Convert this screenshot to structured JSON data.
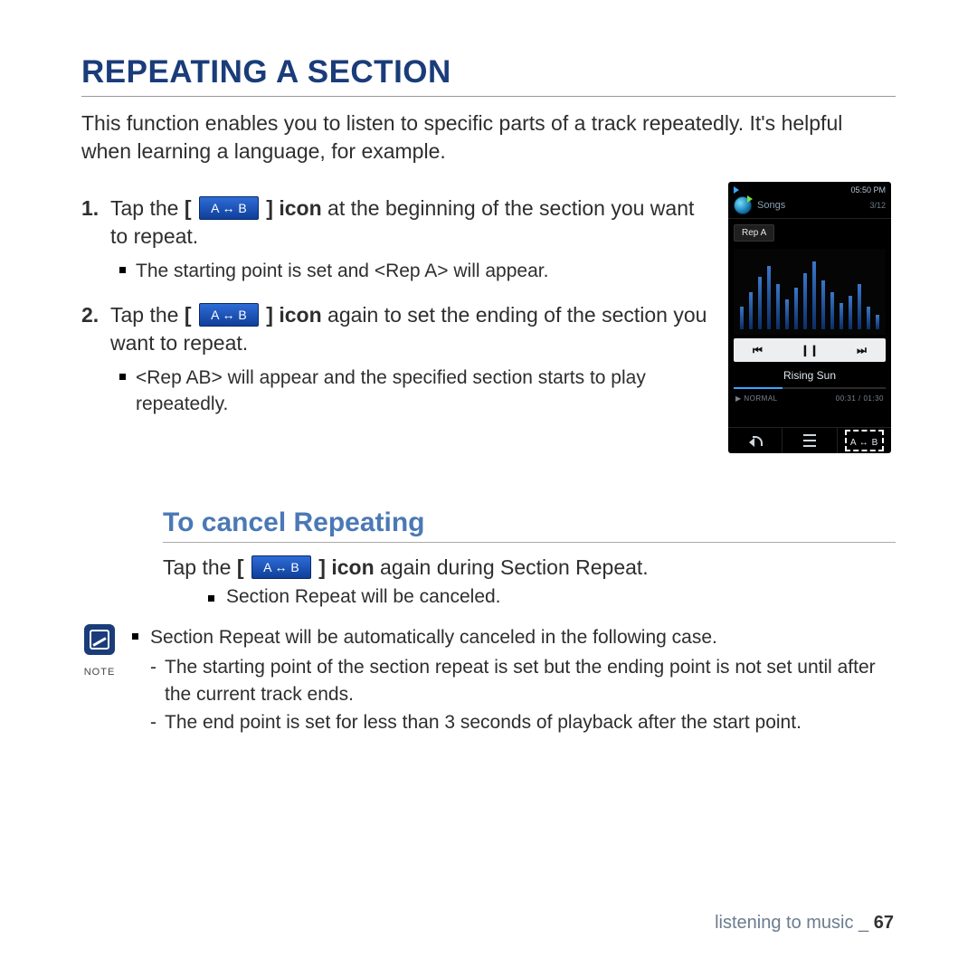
{
  "heading": "REPEATING A SECTION",
  "intro": "This function enables you to listen to specific parts of a track repeatedly. It's helpful when learning a language, for example.",
  "ab_icon_label": "A ↔ B",
  "step1_pre": "Tap the",
  "step1_bracket_open": "[",
  "step1_bracket_close": "]",
  "step1_bold": "icon",
  "step1_post": " at the beginning of the section you want to repeat.",
  "bullet1": "The starting point is set and <Rep A> will appear.",
  "step2_pre": "Tap the",
  "step2_bold": "icon",
  "step2_post": " again to set the ending of the section you want to repeat.",
  "bullet2": "<Rep AB> will appear and the specified section starts to play repeatedly.",
  "subheading": "To cancel Repeating",
  "cancel_pre": "Tap the",
  "cancel_bold": "icon",
  "cancel_post": " again during Section Repeat.",
  "cancel_bullet": "Section Repeat will be canceled.",
  "note_label": "NOTE",
  "note_bullet": "Section Repeat will be automatically canceled in the following case.",
  "note_dash1": "The starting point of the section repeat is set but the ending point is not set until after the current track ends.",
  "note_dash2": "The end point is set for less than 3 seconds of playback after the start point.",
  "footer_section": "listening to music",
  "footer_sep": " _ ",
  "footer_page": "67",
  "device": {
    "time": "05:50 PM",
    "battery_icon": "▮▮",
    "header_label": "Songs",
    "count": "3/12",
    "rep_badge": "Rep A",
    "track": "Rising Sun",
    "status_left": "▶  NORMAL",
    "status_right": "00:31 / 01:30",
    "prev": "⏮",
    "pause": "❙❙",
    "next": "⏭",
    "ab_small": "A ↔ B"
  }
}
